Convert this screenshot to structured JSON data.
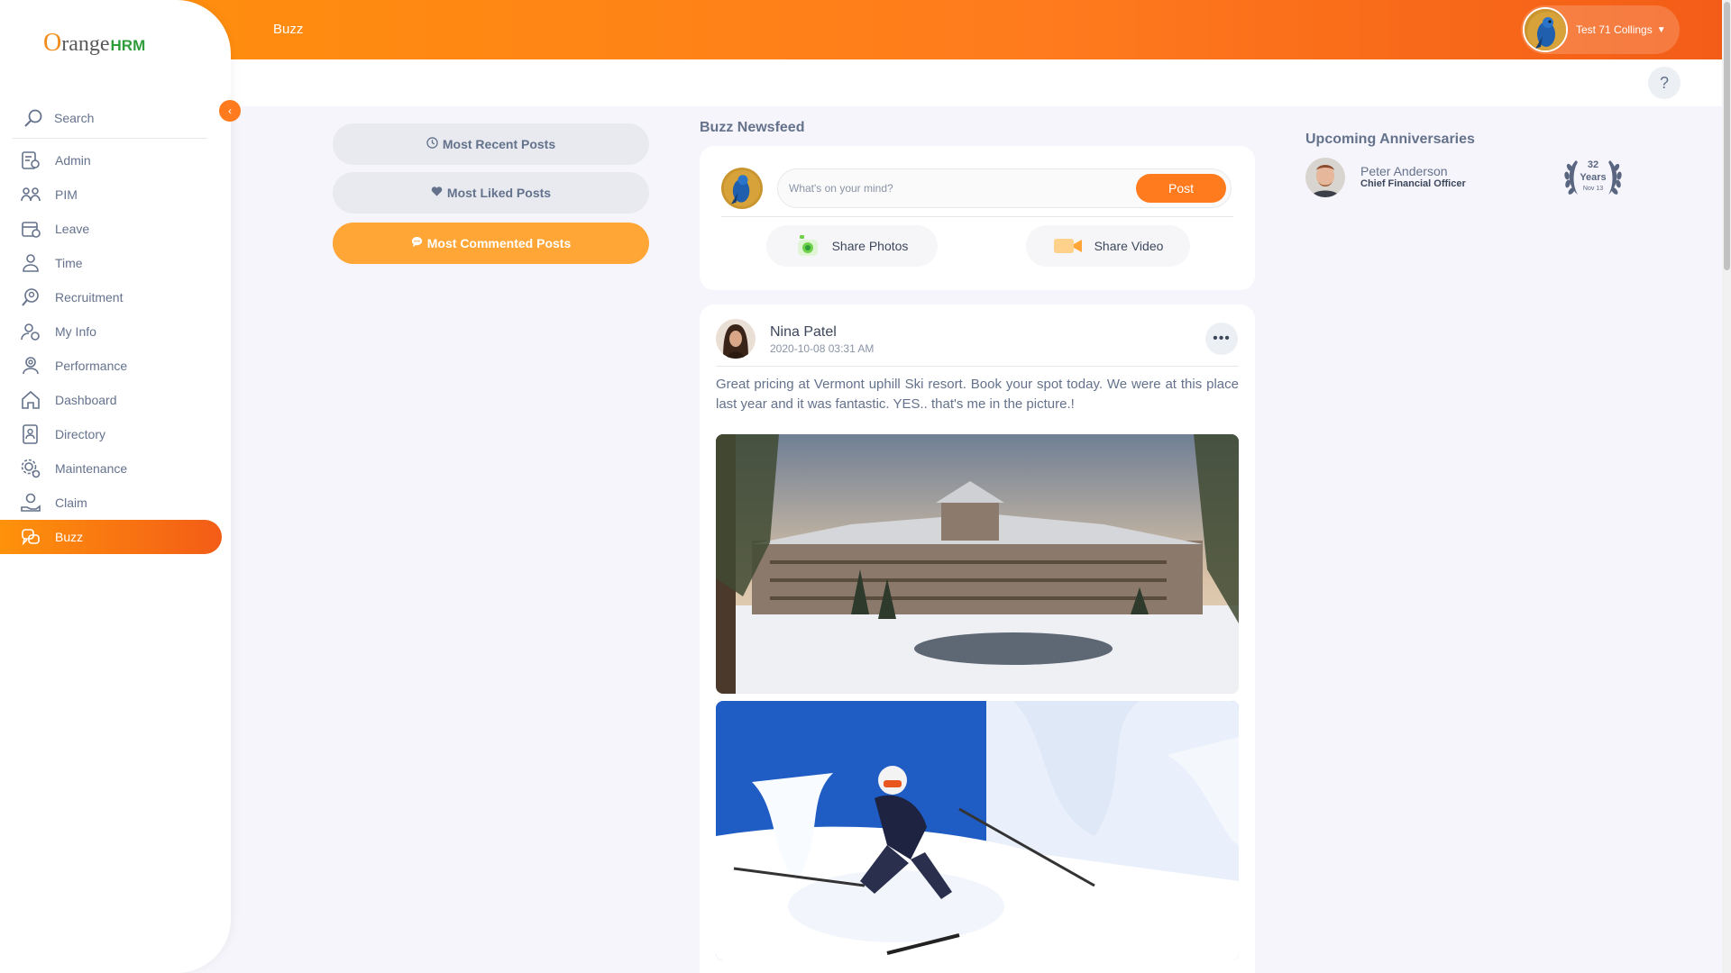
{
  "header": {
    "breadcrumb": "Buzz",
    "user_name": "Test 71 Collings",
    "caret": "▼",
    "help": "?"
  },
  "brand": {
    "logo_o": "O",
    "logo_range": "range",
    "logo_hrm": "HRM",
    "colors": {
      "orange": "#ff7b1d",
      "green": "#2f9c3b"
    }
  },
  "sidebar": {
    "search_placeholder": "Search",
    "collapse_glyph": "‹",
    "items": [
      {
        "label": "Admin",
        "icon": "admin-icon"
      },
      {
        "label": "PIM",
        "icon": "pim-icon"
      },
      {
        "label": "Leave",
        "icon": "leave-icon"
      },
      {
        "label": "Time",
        "icon": "time-icon"
      },
      {
        "label": "Recruitment",
        "icon": "recruitment-icon"
      },
      {
        "label": "My Info",
        "icon": "my-info-icon"
      },
      {
        "label": "Performance",
        "icon": "performance-icon"
      },
      {
        "label": "Dashboard",
        "icon": "dashboard-icon"
      },
      {
        "label": "Directory",
        "icon": "directory-icon"
      },
      {
        "label": "Maintenance",
        "icon": "maintenance-icon"
      },
      {
        "label": "Claim",
        "icon": "claim-icon"
      },
      {
        "label": "Buzz",
        "icon": "buzz-icon",
        "active": true
      }
    ]
  },
  "filters": {
    "recent": "Most Recent Posts",
    "liked": "Most Liked Posts",
    "commented": "Most Commented Posts",
    "active": "commented"
  },
  "newsfeed": {
    "title": "Buzz Newsfeed",
    "composer": {
      "placeholder": "What's on your mind?",
      "post_label": "Post",
      "share_photos": "Share Photos",
      "share_video": "Share Video"
    },
    "post": {
      "author": "Nina Patel",
      "date": "2020-10-08 03:31 AM",
      "more": "•••",
      "text": "Great pricing at Vermont uphill Ski resort. Book your spot today. We were at this place last year and it was fantastic. YES.. that's me in the picture.!"
    }
  },
  "anniversaries": {
    "title": "Upcoming Anniversaries",
    "person": {
      "name": "Peter Anderson",
      "role": "Chief Financial Officer",
      "years": "32",
      "years_label": "Years",
      "date": "Nov 13"
    }
  }
}
